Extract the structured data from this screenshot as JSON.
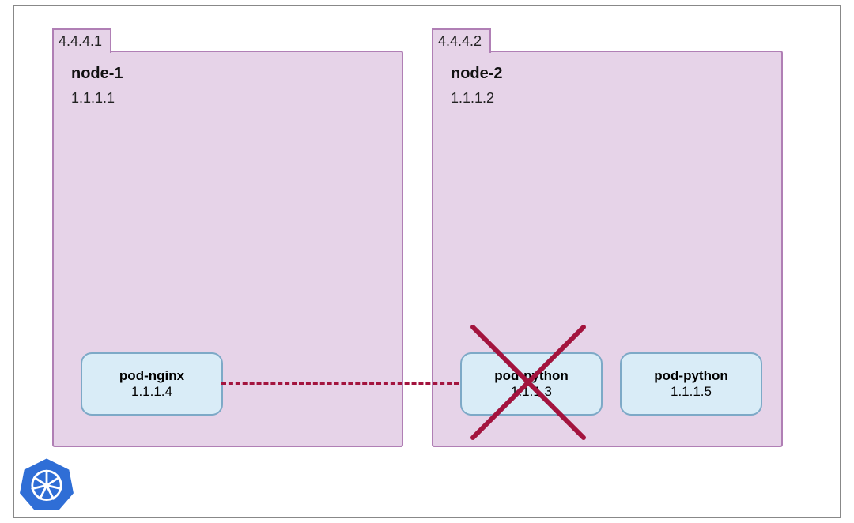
{
  "cluster": {
    "nodes": [
      {
        "tab_ip": "4.4.4.1",
        "name": "node-1",
        "internal_ip": "1.1.1.1",
        "pods": [
          {
            "name": "pod-nginx",
            "ip": "1.1.1.4",
            "crossed_out": false
          }
        ]
      },
      {
        "tab_ip": "4.4.4.2",
        "name": "node-2",
        "internal_ip": "1.1.1.2",
        "pods": [
          {
            "name": "pod-python",
            "ip": "1.1.1.3",
            "crossed_out": true
          },
          {
            "name": "pod-python",
            "ip": "1.1.1.5",
            "crossed_out": false
          }
        ]
      }
    ],
    "connection": {
      "from": "pod-nginx",
      "to": "pod-python (1.1.1.3)",
      "style": "dashed"
    }
  },
  "logo": "kubernetes"
}
